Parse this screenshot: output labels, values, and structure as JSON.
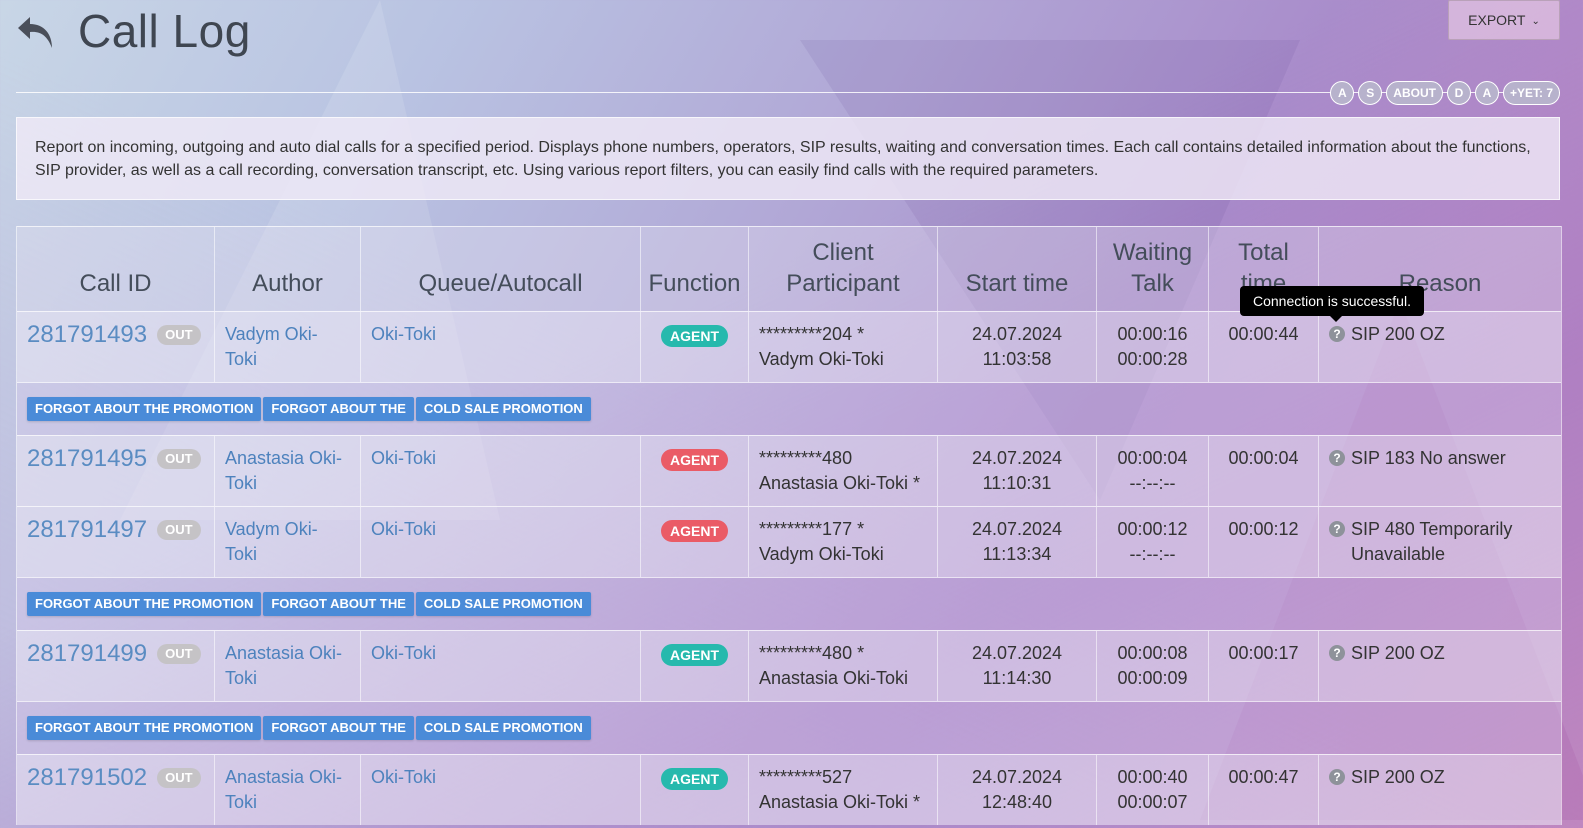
{
  "page": {
    "title": "Call Log",
    "export_label": "EXPORT",
    "description": "Report on incoming, outgoing and auto dial calls for a specified period. Displays phone numbers, operators, SIP results, waiting and conversation times. Each call contains detailed information about the functions, SIP provider, as well as a call recording, conversation transcript, etc. Using various report filters, you can easily find calls with the required parameters."
  },
  "tags": [
    "A",
    "S",
    "ABOUT",
    "D",
    "A",
    "+YET: 7"
  ],
  "columns": {
    "call_id": "Call ID",
    "author": "Author",
    "queue": "Queue/Autocall",
    "function": "Function",
    "client_1": "Client",
    "client_2": "Participant",
    "start": "Start time",
    "waiting_1": "Waiting",
    "waiting_2": "Talk",
    "total_1": "Total",
    "total_2": "time",
    "reason": "Reason"
  },
  "tooltip": "Connection is successful.",
  "promo_tags": [
    "FORGOT ABOUT THE PROMOTION",
    "FORGOT ABOUT THE",
    "COLD SALE PROMOTION"
  ],
  "rows": [
    {
      "id": "281791493",
      "dir": "OUT",
      "author_1": "Vadym Oki-",
      "author_2": "Toki",
      "queue": "Oki-Toki",
      "function": "AGENT",
      "client_1": "*********204 *",
      "client_2": "Vadym Oki-Toki",
      "date": "24.07.2024",
      "time": "11:03:58",
      "wait": "00:00:16",
      "talk": "00:00:28",
      "total": "00:00:44",
      "reason": "SIP 200 OZ"
    },
    {
      "id": "281791495",
      "dir": "OUT",
      "author_1": "Anastasia Oki-",
      "author_2": "Toki",
      "queue": "Oki-Toki",
      "function": "AGENT",
      "client_1": "*********480",
      "client_2": "Anastasia Oki-Toki *",
      "date": "24.07.2024",
      "time": "11:10:31",
      "wait": "00:00:04",
      "talk": "--:--:--",
      "total": "00:00:04",
      "reason": "SIP 183 No answer"
    },
    {
      "id": "281791497",
      "dir": "OUT",
      "author_1": "Vadym Oki-",
      "author_2": "Toki",
      "queue": "Oki-Toki",
      "function": "AGENT",
      "client_1": "*********177 *",
      "client_2": "Vadym Oki-Toki",
      "date": "24.07.2024",
      "time": "11:13:34",
      "wait": "00:00:12",
      "talk": "--:--:--",
      "total": "00:00:12",
      "reason_1": "SIP 480 Temporarily",
      "reason_2": "Unavailable"
    },
    {
      "id": "281791499",
      "dir": "OUT",
      "author_1": "Anastasia Oki-",
      "author_2": "Toki",
      "queue": "Oki-Toki",
      "function": "AGENT",
      "client_1": "*********480 *",
      "client_2": "Anastasia Oki-Toki",
      "date": "24.07.2024",
      "time": "11:14:30",
      "wait": "00:00:08",
      "talk": "00:00:09",
      "total": "00:00:17",
      "reason": "SIP 200 OZ"
    },
    {
      "id": "281791502",
      "dir": "OUT",
      "author_1": "Anastasia Oki-",
      "author_2": "Toki",
      "queue": "Oki-Toki",
      "function": "AGENT",
      "client_1": "*********527",
      "client_2": "Anastasia Oki-Toki *",
      "date": "24.07.2024",
      "time": "12:48:40",
      "wait": "00:00:40",
      "talk": "00:00:07",
      "total": "00:00:47",
      "reason": "SIP 200 OZ"
    }
  ]
}
